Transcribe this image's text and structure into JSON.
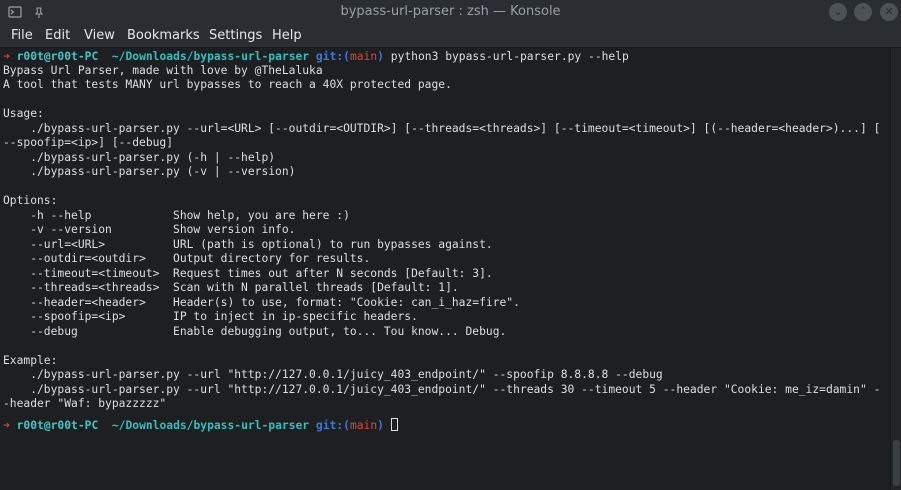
{
  "window": {
    "title": "bypass-url-parser : zsh — Konsole",
    "controls": {
      "minimize": "⌄",
      "maximize": "˄",
      "close": "✕"
    }
  },
  "menu": [
    "File",
    "Edit",
    "View",
    "Bookmarks",
    "Settings",
    "Help"
  ],
  "prompt": {
    "arrow": "➜",
    "user": "r00t@r00t-PC",
    "path": "~/Downloads/bypass-url-parser",
    "git_prefix": "git:(",
    "branch": "main",
    "git_suffix": ")",
    "command": "python3 bypass-url-parser.py --help"
  },
  "output": [
    "Bypass Url Parser, made with love by @TheLaluka",
    "A tool that tests MANY url bypasses to reach a 40X protected page.",
    "",
    "Usage:",
    "    ./bypass-url-parser.py --url=<URL> [--outdir=<OUTDIR>] [--threads=<threads>] [--timeout=<timeout>] [(--header=<header>)...] [",
    "--spoofip=<ip>] [--debug]",
    "    ./bypass-url-parser.py (-h | --help)",
    "    ./bypass-url-parser.py (-v | --version)",
    "",
    "Options:",
    "    -h --help            Show help, you are here :)",
    "    -v --version         Show version info.",
    "    --url=<URL>          URL (path is optional) to run bypasses against.",
    "    --outdir=<outdir>    Output directory for results.",
    "    --timeout=<timeout>  Request times out after N seconds [Default: 3].",
    "    --threads=<threads>  Scan with N parallel threads [Default: 1].",
    "    --header=<header>    Header(s) to use, format: \"Cookie: can_i_haz=fire\".",
    "    --spoofip=<ip>       IP to inject in ip-specific headers.",
    "    --debug              Enable debugging output, to... Tou know... Debug.",
    "",
    "Example:",
    "    ./bypass-url-parser.py --url \"http://127.0.0.1/juicy_403_endpoint/\" --spoofip 8.8.8.8 --debug",
    "    ./bypass-url-parser.py --url \"http://127.0.0.1/juicy_403_endpoint/\" --threads 30 --timeout 5 --header \"Cookie: me_iz=damin\" -",
    "-header \"Waf: bypazzzzz\""
  ],
  "scroll": {
    "position": 1.0
  }
}
